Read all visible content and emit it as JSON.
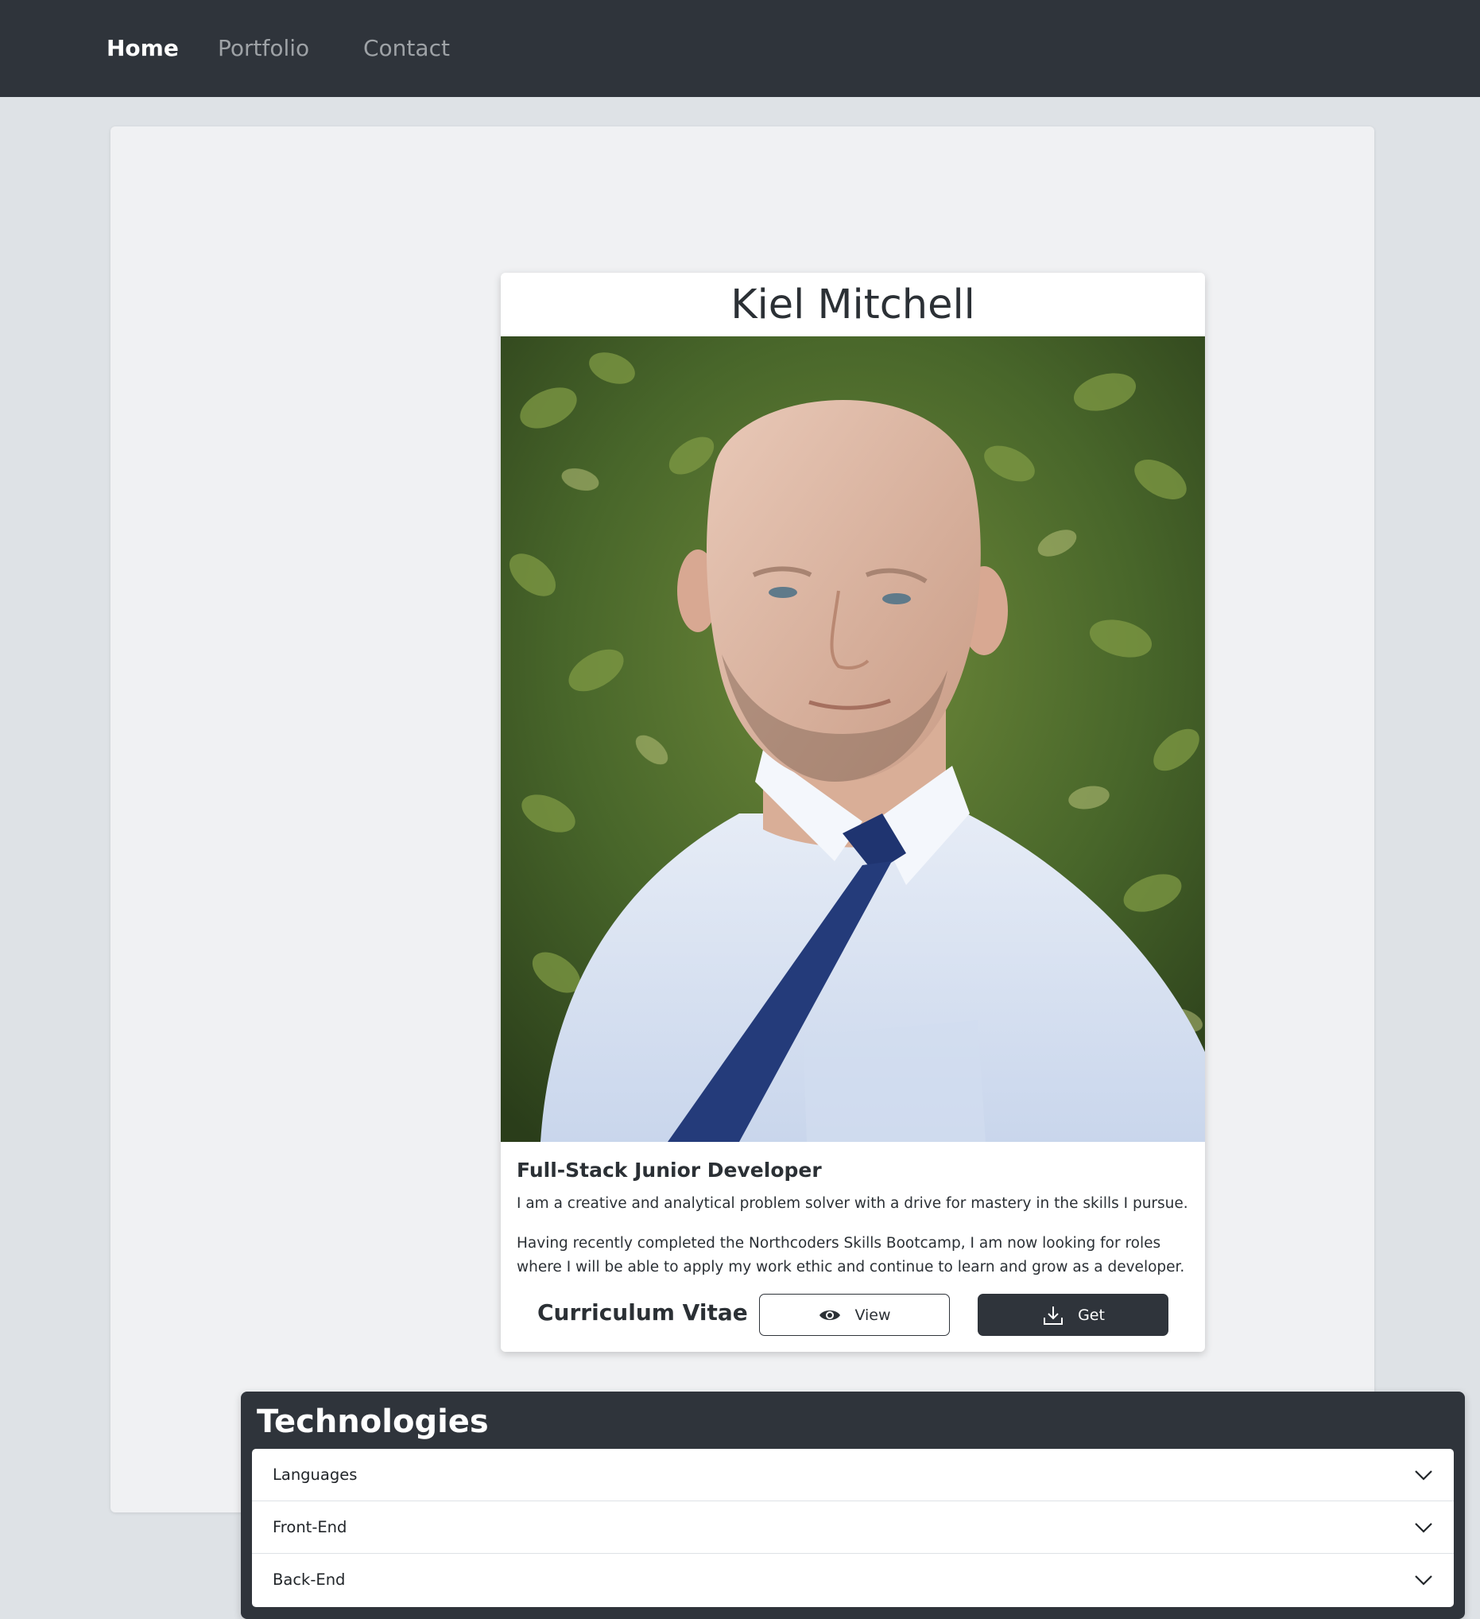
{
  "nav": {
    "items": [
      {
        "label": "Home",
        "active": true
      },
      {
        "label": "Portfolio",
        "active": false
      },
      {
        "label": "Contact",
        "active": false
      }
    ]
  },
  "profile": {
    "name": "Kiel Mitchell",
    "photo_description": "portrait",
    "role": "Full-Stack Junior Developer",
    "bio": [
      "I am a creative and analytical problem solver with a drive for mastery in the skills I pursue.",
      "Having recently completed the Northcoders Skills Bootcamp, I am now looking for roles where I will be able to apply my work ethic and continue to learn and grow as a developer."
    ],
    "cv": {
      "label": "Curriculum Vitae",
      "view_label": "View",
      "view_icon": "eye-icon",
      "get_label": "Get",
      "get_icon": "download-icon"
    }
  },
  "technologies": {
    "title": "Technologies",
    "sections": [
      {
        "label": "Languages",
        "icon": "chevron-down-icon"
      },
      {
        "label": "Front-End",
        "icon": "chevron-down-icon"
      },
      {
        "label": "Back-End",
        "icon": "chevron-down-icon"
      }
    ]
  },
  "colors": {
    "navbar_bg": "#2f343b",
    "page_bg": "#dee2e6",
    "panel_bg": "#f0f1f3",
    "card_bg": "#ffffff",
    "dark_button": "#2f343b",
    "nav_inactive": "#9ea2a6"
  }
}
